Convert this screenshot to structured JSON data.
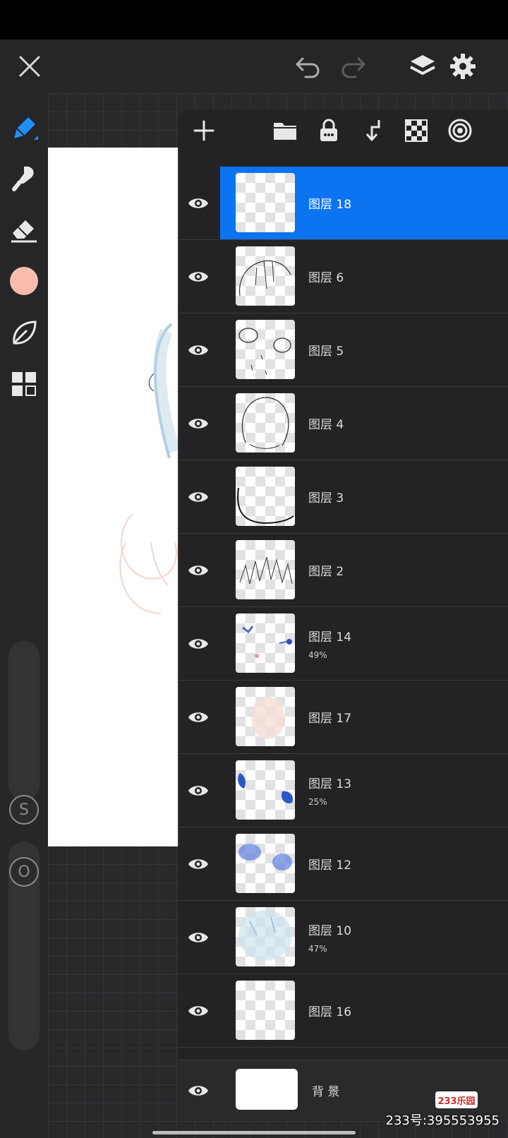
{
  "app": {
    "top_bar": {
      "close_icon": "close-icon",
      "undo_icon": "undo-icon",
      "redo_icon": "redo-icon",
      "layers_icon": "layers-icon",
      "settings_icon": "gear-icon"
    },
    "tools": [
      "brush-tool-icon",
      "smudge-tool-icon",
      "eraser-tool-icon",
      "color-swatch",
      "leaf-tool-icon",
      "gallery-grid-icon"
    ],
    "current_color": "#f7bcae",
    "size_slider_label": "S",
    "opacity_slider_label": "O"
  },
  "layers_panel": {
    "toolbar": [
      "add-layer-icon",
      "folder-icon",
      "lock-icon",
      "merge-down-icon",
      "transparency-checker-icon",
      "blend-mode-icon"
    ],
    "accent_color": "#0c74f0",
    "layers": [
      {
        "name": "图层 18",
        "opacity": "",
        "selected": true
      },
      {
        "name": "图层 6",
        "opacity": ""
      },
      {
        "name": "图层 5",
        "opacity": ""
      },
      {
        "name": "图层 4",
        "opacity": ""
      },
      {
        "name": "图层 3",
        "opacity": ""
      },
      {
        "name": "图层 2",
        "opacity": ""
      },
      {
        "name": "图层 14",
        "opacity": "49%"
      },
      {
        "name": "图层 17",
        "opacity": ""
      },
      {
        "name": "图层 13",
        "opacity": "25%"
      },
      {
        "name": "图层 12",
        "opacity": ""
      },
      {
        "name": "图层 10",
        "opacity": "47%"
      },
      {
        "name": "图层 16",
        "opacity": ""
      }
    ],
    "background_layer": {
      "name": "背 景"
    }
  },
  "watermark": {
    "logo": "233乐园",
    "text": "233号:395553955"
  }
}
